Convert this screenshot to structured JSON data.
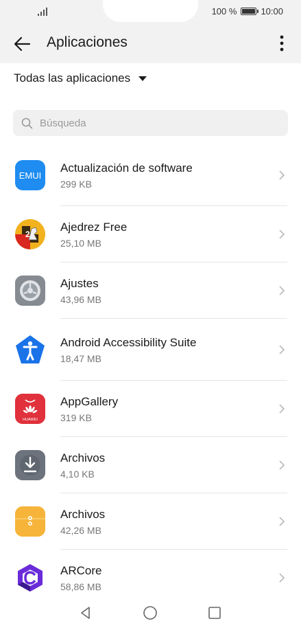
{
  "status": {
    "battery_text": "100 %",
    "time": "10:00"
  },
  "appbar": {
    "title": "Aplicaciones"
  },
  "filter": {
    "label": "Todas las aplicaciones"
  },
  "search": {
    "placeholder": "Búsqueda"
  },
  "apps": [
    {
      "name": "Actualización de software",
      "size": "299 KB",
      "icon": "emui-update-icon"
    },
    {
      "name": "Ajedrez Free",
      "size": "25,10 MB",
      "icon": "chess-icon"
    },
    {
      "name": "Ajustes",
      "size": "43,96 MB",
      "icon": "settings-gear-icon"
    },
    {
      "name": "Android Accessibility Suite",
      "size": "18,47 MB",
      "icon": "accessibility-icon"
    },
    {
      "name": "AppGallery",
      "size": "319 KB",
      "icon": "appgallery-icon",
      "icon_text": "HUAWEI"
    },
    {
      "name": "Archivos",
      "size": "4,10 KB",
      "icon": "download-files-icon"
    },
    {
      "name": "Archivos",
      "size": "42,26 MB",
      "icon": "files-folder-icon"
    },
    {
      "name": "ARCore",
      "size": "58,86 MB",
      "icon": "arcore-icon"
    }
  ],
  "colors": {
    "emui_blue": "#1e8cf0",
    "appgallery_red": "#e0313c",
    "accessibility_blue": "#1a73e8",
    "files_yellow": "#f5b12f",
    "arcore_purple": "#6a2bd9"
  }
}
